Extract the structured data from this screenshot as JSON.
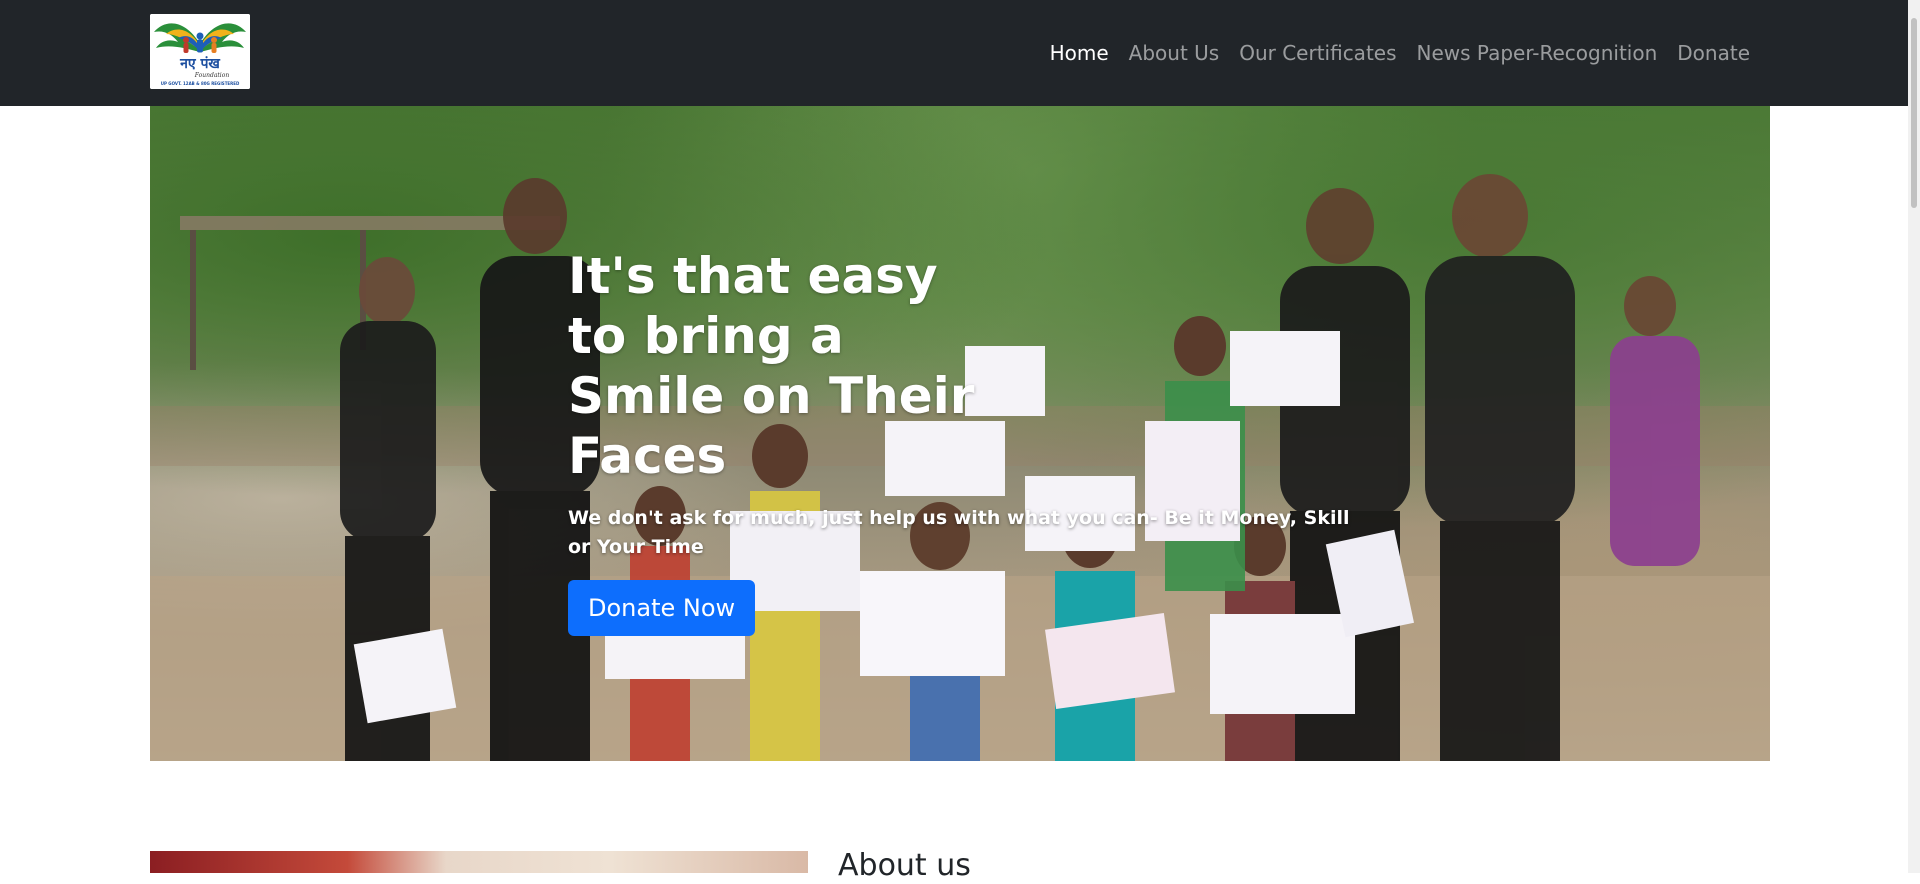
{
  "navbar": {
    "links": [
      {
        "label": "Home",
        "active": true
      },
      {
        "label": "About Us",
        "active": false
      },
      {
        "label": "Our Certificates",
        "active": false
      },
      {
        "label": "News Paper-Recognition",
        "active": false
      },
      {
        "label": "Donate",
        "active": false
      }
    ],
    "background": "#212529"
  },
  "brand": {
    "logo_text": "नए पंख",
    "logo_sub": "Foundation",
    "logo_caption": "UP GOVT. 12AB & 80G REGISTERED"
  },
  "hero": {
    "title": "It's that easy to bring a Smile on Their Faces",
    "subtitle": "We don't ask for much, just help us with what you can- Be it Money, Skill or Your Time",
    "cta_label": "Donate Now",
    "cta_color": "#0d6efd"
  },
  "about": {
    "heading": "About us"
  }
}
